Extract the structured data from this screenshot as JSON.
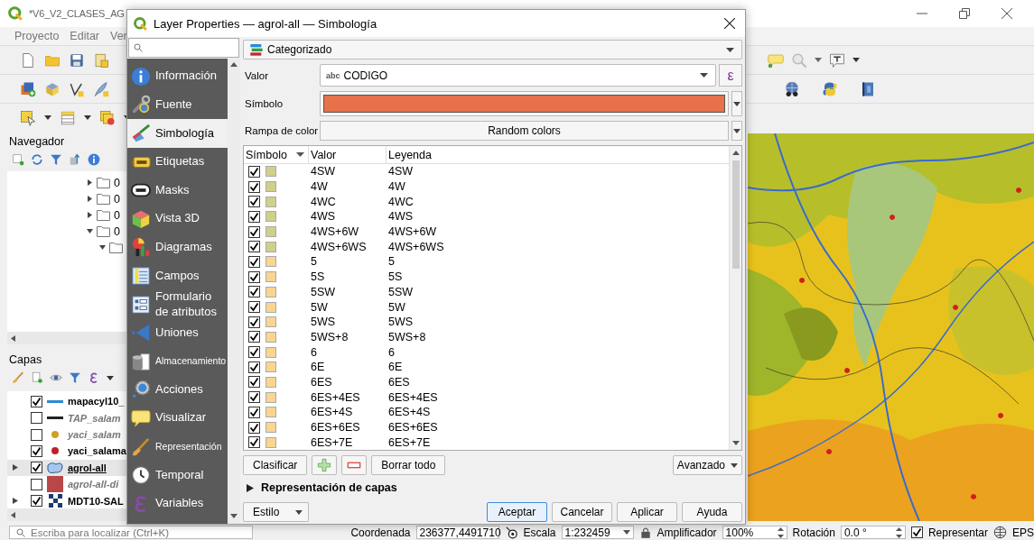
{
  "main_window": {
    "title": "*V6_V2_CLASES_AG",
    "menu": [
      "Proyecto",
      "Editar",
      "Ver"
    ]
  },
  "navigator": {
    "title": "Navegador",
    "items": [
      {
        "label": "0",
        "expanded": false
      },
      {
        "label": "0",
        "expanded": false
      },
      {
        "label": "0",
        "expanded": false
      },
      {
        "label": "0",
        "expanded": true,
        "children": [
          {
            "expanded": true
          }
        ]
      }
    ]
  },
  "layers_panel": {
    "title": "Capas",
    "layers": [
      {
        "name": "mapacyl10_",
        "checked": true,
        "selected": false,
        "kind": "line",
        "color": "#2d8ad0"
      },
      {
        "name": "TAP_salam",
        "checked": false,
        "selected": false,
        "kind": "line",
        "color": "#222222"
      },
      {
        "name": "yaci_salam",
        "checked": false,
        "selected": false,
        "kind": "point",
        "color": "#d0a020"
      },
      {
        "name": "yaci_salama",
        "checked": true,
        "selected": false,
        "kind": "point",
        "color": "#c0202a"
      },
      {
        "name": "agrol-all",
        "checked": true,
        "selected": true,
        "kind": "polygon",
        "color": "#a7c7ea",
        "expanded": false
      },
      {
        "name": "agrol-all-di",
        "checked": false,
        "selected": false,
        "kind": "fill",
        "color": "#b84848"
      },
      {
        "name": "MDT10-SAL",
        "checked": true,
        "selected": false,
        "kind": "raster",
        "color": "#1e3a70",
        "expanded": false
      }
    ]
  },
  "status_bar": {
    "search_placeholder": "Escriba para localizar (Ctrl+K)",
    "coordinate_label": "Coordenada",
    "coordinate": "236377,4491710",
    "scale_label": "Escala",
    "scale": "1:232459",
    "magnifier_label": "Amplificador",
    "magnifier": "100%",
    "rotation_label": "Rotación",
    "rotation": "0.0 °",
    "render_label": "Representar",
    "render_checked": true,
    "crs": "EPS"
  },
  "dialog": {
    "title": "Layer Properties — agrol-all — Simbología",
    "sidebar": [
      {
        "label": "Información",
        "selected": false
      },
      {
        "label": "Fuente",
        "selected": false
      },
      {
        "label": "Simbología",
        "selected": true
      },
      {
        "label": "Etiquetas",
        "selected": false
      },
      {
        "label": "Masks",
        "selected": false
      },
      {
        "label": "Vista 3D",
        "selected": false
      },
      {
        "label": "Diagramas",
        "selected": false
      },
      {
        "label": "Campos",
        "selected": false
      },
      {
        "label": "Formulario de atributos",
        "selected": false
      },
      {
        "label": "Uniones",
        "selected": false
      },
      {
        "label": "Almacenamiento",
        "selected": false,
        "small": true
      },
      {
        "label": "Acciones",
        "selected": false
      },
      {
        "label": "Visualizar",
        "selected": false
      },
      {
        "label": "Representación",
        "selected": false,
        "small": true
      },
      {
        "label": "Temporal",
        "selected": false
      },
      {
        "label": "Variables",
        "selected": false
      }
    ],
    "renderer": "Categorizado",
    "value_label": "Valor",
    "value_type": "abc",
    "value": "CODIGO",
    "expression_button": "ε",
    "symbol_label": "Símbolo",
    "symbol": {
      "color": "#e6714a"
    },
    "ramp_label": "Rampa de color",
    "ramp": "Random colors",
    "columns": [
      "Símbolo",
      "Valor",
      "Leyenda"
    ],
    "categories": [
      {
        "checked": true,
        "color": "#cfd08a",
        "value": "4SW",
        "legend": "4SW"
      },
      {
        "checked": true,
        "color": "#cfd08a",
        "value": "4W",
        "legend": "4W"
      },
      {
        "checked": true,
        "color": "#cfd08a",
        "value": "4WC",
        "legend": "4WC"
      },
      {
        "checked": true,
        "color": "#cfd08a",
        "value": "4WS",
        "legend": "4WS"
      },
      {
        "checked": true,
        "color": "#cfd08a",
        "value": "4WS+6W",
        "legend": "4WS+6W"
      },
      {
        "checked": true,
        "color": "#cfd08a",
        "value": "4WS+6WS",
        "legend": "4WS+6WS"
      },
      {
        "checked": true,
        "color": "#f9d590",
        "value": "5",
        "legend": "5"
      },
      {
        "checked": true,
        "color": "#f9d590",
        "value": "5S",
        "legend": "5S"
      },
      {
        "checked": true,
        "color": "#f9d590",
        "value": "5SW",
        "legend": "5SW"
      },
      {
        "checked": true,
        "color": "#f9d590",
        "value": "5W",
        "legend": "5W"
      },
      {
        "checked": true,
        "color": "#f9d590",
        "value": "5WS",
        "legend": "5WS"
      },
      {
        "checked": true,
        "color": "#f9d590",
        "value": "5WS+8",
        "legend": "5WS+8"
      },
      {
        "checked": true,
        "color": "#f9d590",
        "value": "6",
        "legend": "6"
      },
      {
        "checked": true,
        "color": "#f9d590",
        "value": "6E",
        "legend": "6E"
      },
      {
        "checked": true,
        "color": "#f9d590",
        "value": "6ES",
        "legend": "6ES"
      },
      {
        "checked": true,
        "color": "#f9d590",
        "value": "6ES+4ES",
        "legend": "6ES+4ES"
      },
      {
        "checked": true,
        "color": "#f9d590",
        "value": "6ES+4S",
        "legend": "6ES+4S"
      },
      {
        "checked": true,
        "color": "#f9d590",
        "value": "6ES+6ES",
        "legend": "6ES+6ES"
      },
      {
        "checked": true,
        "color": "#f9d590",
        "value": "6ES+7E",
        "legend": "6ES+7E"
      }
    ],
    "classify_button": "Clasificar",
    "delete_all_button": "Borrar todo",
    "advanced_button": "Avanzado",
    "section": {
      "label": "Representación de capas",
      "expanded": false
    },
    "style_button": "Estilo",
    "buttons": [
      {
        "label": "Aceptar",
        "default": true
      },
      {
        "label": "Cancelar",
        "default": false
      },
      {
        "label": "Aplicar",
        "default": false
      },
      {
        "label": "Ayuda",
        "default": false
      }
    ]
  }
}
